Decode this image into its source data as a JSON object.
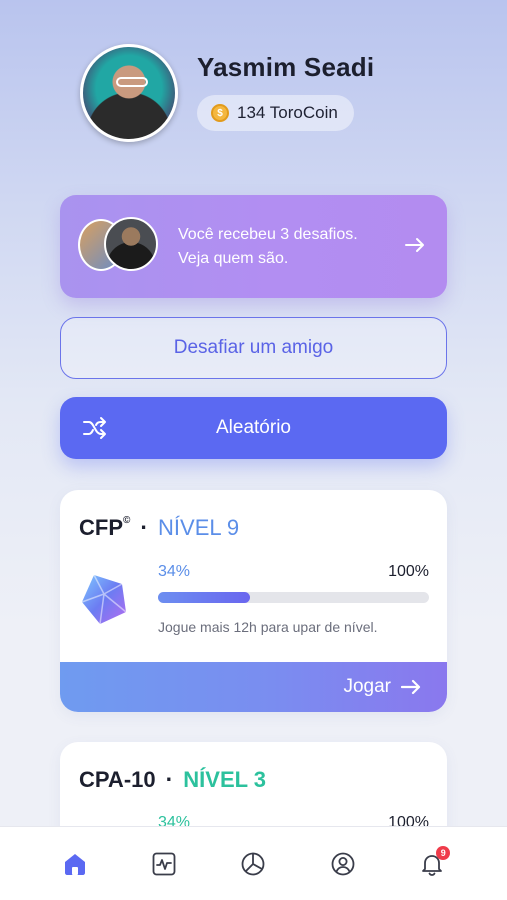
{
  "profile": {
    "name": "Yasmim Seadi",
    "coins": "134 ToroCoin"
  },
  "challenge_banner": {
    "line1": "Você recebeu 3 desafios.",
    "line2": "Veja quem são."
  },
  "actions": {
    "challenge_friend": "Desafiar um amigo",
    "random": "Aleatório"
  },
  "cards": [
    {
      "course": "CFP",
      "mark": "©",
      "level": "NÍVEL 9",
      "progress_label": "34%",
      "max_label": "100%",
      "progress": 0.34,
      "hint": "Jogue mais 12h para upar de nível.",
      "play": "Jogar",
      "accent": "#5b8ee8"
    },
    {
      "course": "CPA-10",
      "level": "NÍVEL 3",
      "progress_label": "34%",
      "max_label": "100%",
      "accent": "#2cc19d"
    }
  ],
  "nav": {
    "items": [
      "home-icon",
      "activity-icon",
      "chart-icon",
      "profile-icon",
      "bell-icon"
    ],
    "notification_count": "9"
  },
  "colors": {
    "primary": "#5b69f2",
    "banner": "#b28ef2",
    "badge": "#ef3b4a"
  }
}
